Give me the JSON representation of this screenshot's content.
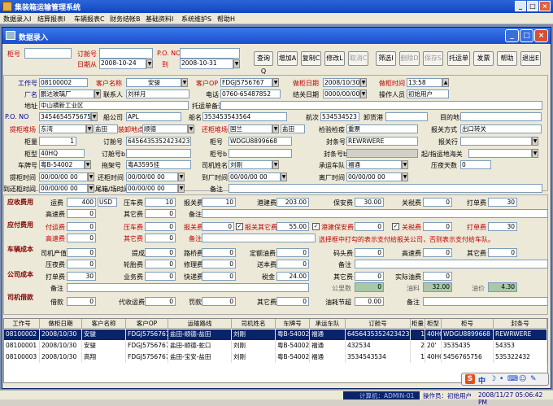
{
  "app": {
    "title": "集装箱运输管理系统"
  },
  "menu": [
    "数据录入I",
    "结算报表I",
    "车辆报表C",
    "财务结帐B",
    "基础资料I",
    "系统维护S",
    "帮助H"
  ],
  "child": {
    "title": "数据录入"
  },
  "search": {
    "box_no_label": "柜号",
    "order_no_label": "订舱号",
    "po_label": "P.O. NO",
    "date_from_label": "日期从",
    "date_to_label": "到",
    "date_from": "2008-10-24",
    "date_to": "2008-10-31"
  },
  "toolbar": [
    "查询Q",
    "增加A",
    "复制C",
    "修改L",
    "取消C",
    "筛选I",
    "删除D",
    "保存S",
    "托运单",
    "发票",
    "帮助",
    "退出E"
  ],
  "form": {
    "job_no_label": "工作号",
    "job_no": "08100002",
    "customer_label": "客户名称",
    "customer": "安骏",
    "customer_op_label": "客户OP",
    "customer_op": "FDGJ5756767",
    "pack_date_label": "做柜日期",
    "pack_date": "2008/10/30",
    "pack_time_label": "做柜时间",
    "pack_time": "13:58",
    "factory_label": "厂名",
    "factory": "鹏达玻璃厂",
    "contact_label": "联系人",
    "contact": "刘祥月",
    "phone_label": "电话",
    "phone": "0760-65487852",
    "settle_date_label": "结关日期",
    "settle_date": "0000/00/00",
    "operator_label": "操作人员",
    "operator": "初始用户",
    "address_label": "地址",
    "address": "中山横新工业区",
    "consign_label": "托运单备注",
    "pono_label": "P.O. NO",
    "pono": "3454654575675",
    "ship_co_label": "船公司",
    "ship_co": "APL",
    "vessel_label": "船名",
    "vessel": "353453543564",
    "voyage_label": "航次",
    "voyage": "534534523",
    "unload_port_label": "卸货港",
    "dest_label": "目的地",
    "pickup_label": "提柜堆场",
    "pickup": "东湾",
    "pickup2": "盐田",
    "load_label": "装卸地点",
    "load": "顺德",
    "return_label": "还柜堆场",
    "return": "国兰",
    "return2": "盐田",
    "inspect_label": "检验检疫",
    "inspect": "重票",
    "customs_label": "报关方式",
    "customs": "出口转关",
    "qty_label": "柜量",
    "qty": "1",
    "order_label": "订舱号",
    "order": "6456435352423423",
    "box_label": "柜号",
    "box": "WDGU8899668",
    "seal_label": "封条号",
    "seal": "REWRWERE",
    "customs_place_label": "报关行",
    "type_label": "柜型",
    "type": "40HQ",
    "order_b_label": "订舱号b",
    "box_b_label": "柜号b",
    "seal_b_label": "封条号b",
    "port_label": "起/指运地海关",
    "plate_label": "车牌号",
    "plate": "粤B-54002",
    "trailer_label": "拖架号",
    "trailer": "粤A3595挂",
    "driver_label": "司机姓名",
    "driver": "刘刚",
    "team_label": "承运车队",
    "team": "福通",
    "press_label": "压夜天数",
    "press": "0",
    "pick_time_label": "提柜时间",
    "pick_time": "00/00/00 00",
    "ret_time_label": "还柜时间",
    "ret_time": "00/00/00 00",
    "arr_time_label": "到厂时间",
    "arr_time": "00/00/00 00",
    "leave_time_label": "离厂时间",
    "leave_time": "00/00/00 00",
    "arr_ret_label": "到还柜时间",
    "arr_ret": "00/00/00 00",
    "tail_label": "尾箱/场时间",
    "tail": "00/00/00 00",
    "note_label": "备注"
  },
  "fees": {
    "sec_recv": "应收费用",
    "sec_pay": "应付费用",
    "sec_car": "车辆成本",
    "sec_co": "公司成本",
    "sec_drv": "司机借款",
    "freight_label": "运费",
    "freight": "400",
    "currency": "USD",
    "press_fee_label": "压车费",
    "press_fee": "10",
    "declare_fee_label": "报关费",
    "declare_fee": "10",
    "port_fee_label": "港建费",
    "port_fee": "203.00",
    "insp_fee_label": "保安费",
    "insp_fee": "30.00",
    "tax_label": "关税费",
    "tax": "0",
    "pack_fee_label": "打单费",
    "pack_fee": "30",
    "highway_label": "高速费",
    "highway": "0",
    "other_label": "其它费",
    "other": "0",
    "note_label": "备注",
    "pay_freight_label": "付运费",
    "pay_freight": "0",
    "pay_press_label": "压车费",
    "pay_press": "0",
    "pay_declare_label": "报关费",
    "pay_declare": "0",
    "chk_other_label": "报关其它费",
    "chk_other": "55.00",
    "chk_port_label": "港建保安费",
    "chk_port": "0",
    "chk_tax_label": "关税费",
    "chk_tax": "0",
    "pay_pack_label": "打单费",
    "pay_pack": "30",
    "pay_highway_label": "高速费",
    "pay_highway": "0",
    "pay_other_label": "其它费",
    "pay_other": "0",
    "pay_note_label": "备注",
    "hint": "选择框中打勾的表示支付给报关公司，否则表示支付给车队。",
    "drv_value_label": "司机产值",
    "drv_value": "0",
    "commission_label": "提成",
    "commission": "0",
    "toll_label": "路桥费",
    "toll": "0",
    "fixed_fuel_label": "定额油费",
    "fixed_fuel": "0",
    "yard_label": "码头费",
    "yard": "0",
    "high2_label": "高速费",
    "high2": "0",
    "other2_label": "其它费",
    "other2": "0",
    "press2_label": "压夜费",
    "press2": "0",
    "tyre_label": "轮胎费",
    "tyre": "0",
    "repair_label": "修理费",
    "repair": "0",
    "deliver_label": "送本费",
    "deliver": "0",
    "note2_label": "备注",
    "print_label": "打单费",
    "print": "30",
    "biz_label": "业务费",
    "biz": "0",
    "express_label": "快递费",
    "express": "0",
    "tax2_label": "税金",
    "tax2": "24.00",
    "other3_label": "其它费",
    "other3": "0",
    "actual_fuel_label": "实际油费",
    "actual_fuel": "0",
    "note3_label": "备注",
    "km_label": "公里数",
    "km": "0",
    "fuel_qty_label": "油料",
    "fuel_qty": "32.00",
    "fuel_price_label": "油价",
    "fuel_price": "4.30",
    "loan_label": "借款",
    "loan": "0",
    "agent_label": "代收运费",
    "agent": "0",
    "fine_label": "罚款",
    "fine": "0",
    "other4_label": "其它费",
    "other4": "0",
    "fuel_save_label": "油耗节超",
    "fuel_save": "0.00",
    "note4_label": "备注"
  },
  "grid": {
    "headers": [
      "工作号",
      "做柜日期",
      "客户名称",
      "客户OP",
      "运输路线",
      "司机姓名",
      "车牌号",
      "承运车队",
      "订舱号",
      "柜量",
      "柜型",
      "柜号",
      "封条号"
    ],
    "rows": [
      [
        "08100002",
        "2008/10/30",
        "安骏",
        "FDGJ5756767",
        "盐田-顺德-盐田",
        "刘刚",
        "粤B-54002",
        "福通",
        "6456435352423423",
        "1",
        "40HQ",
        "WDGU8899668",
        "REWRWERE"
      ],
      [
        "08100001",
        "2008/10/30",
        "安骏",
        "FDGJ5756767",
        "盐田-顺德-蛇口",
        "刘刚",
        "粤B-54002",
        "福通",
        "432534",
        "2",
        "20'",
        "3535435",
        "54353"
      ],
      [
        "08100003",
        "2008/10/30",
        "高翔",
        "FDGJ5756767",
        "盐田-宝安-盐田",
        "刘刚",
        "粤B-54002",
        "福通",
        "3534543534",
        "1",
        "40HQ",
        "5456765756",
        "535322432"
      ]
    ]
  },
  "status": {
    "computer": "计算机：ADMIN-01",
    "user": "操作员：初始用户",
    "time": "2008/11/27 05:06:42 PM"
  },
  "tray": {
    "s": "S",
    "zh": "中"
  }
}
